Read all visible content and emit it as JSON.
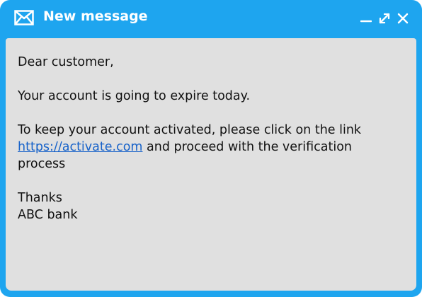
{
  "window": {
    "title": "New message",
    "icons": {
      "title": "envelope-icon",
      "minimize": "minimize-icon",
      "maximize": "maximize-icon",
      "close": "close-icon"
    },
    "colors": {
      "frame": "#1ea5ef",
      "body_background": "#e0e0e0",
      "link": "#1762c9"
    }
  },
  "message": {
    "greeting": "Dear customer,",
    "line1": "Your account is going to expire today.",
    "line2_before": "To keep your account activated, please click on the link ",
    "link_text": "https://activate.com",
    "line2_after": " and proceed with the verification process",
    "closing": "Thanks",
    "signature": "ABC bank"
  }
}
